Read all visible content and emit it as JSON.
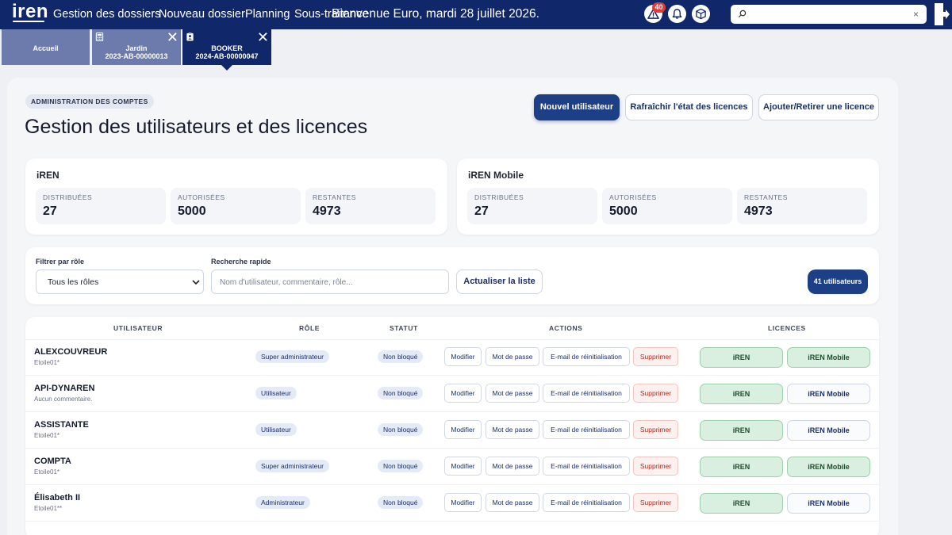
{
  "topbar": {
    "logo": "iren",
    "nav": [
      "Gestion des dossiers",
      "Nouveau dossier",
      "Planning",
      "Sous-traitance"
    ],
    "welcome": "Bienvenue Euro, mardi 28 juillet 2026.",
    "alert_count": "40",
    "icons": [
      "alert-triangle-icon",
      "bell-icon",
      "package-icon",
      "search-icon",
      "logout-icon"
    ],
    "search_clear": "×"
  },
  "tabs": [
    {
      "label": "Accueil"
    },
    {
      "line1": "Jardin",
      "line2": "2023-AB-00000013",
      "icon": "calculator-icon",
      "close": "✕"
    },
    {
      "line1": "BOOKER",
      "line2": "2024-AB-00000047",
      "icon": "id-card-icon",
      "close": "✕"
    }
  ],
  "page": {
    "breadcrumb": "ADMINISTRATION DES COMPTES",
    "title": "Gestion des utilisateurs et des licences",
    "buttons": {
      "new_user": "Nouvel utilisateur",
      "refresh": "Rafraîchir l'état des licences",
      "add_remove": "Ajouter/Retirer une licence"
    }
  },
  "licenses": [
    {
      "name": "iREN",
      "distributed_label": "DISTRIBUÉES",
      "distributed": "27",
      "authorized_label": "AUTORISÉES",
      "authorized": "5000",
      "remaining_label": "RESTANTES",
      "remaining": "4973"
    },
    {
      "name": "iREN Mobile",
      "distributed_label": "DISTRIBUÉES",
      "distributed": "27",
      "authorized_label": "AUTORISÉES",
      "authorized": "5000",
      "remaining_label": "RESTANTES",
      "remaining": "4973"
    }
  ],
  "filters": {
    "role_label": "Filtrer par rôle",
    "role_value": "Tous les rôles",
    "search_label": "Recherche rapide",
    "search_placeholder": "Nom d'utilisateur, commentaire, rôle...",
    "reload": "Actualiser la liste",
    "count": "41 utilisateurs"
  },
  "table": {
    "headers": {
      "user": "UTILISATEUR",
      "role": "RÔLE",
      "status": "STATUT",
      "actions": "ACTIONS",
      "licenses": "LICENCES"
    },
    "action_labels": {
      "edit": "Modifier",
      "password": "Mot de passe",
      "reset_mail": "E-mail de réinitialisation",
      "delete": "Supprimer"
    },
    "license_labels": {
      "iren": "iREN",
      "mobile": "iREN Mobile"
    },
    "rows": [
      {
        "name": "ALEXCOUVREUR",
        "comment": "Etoile01*",
        "role": "Super administrateur",
        "status": "Non bloqué",
        "iren": true,
        "mobile": true
      },
      {
        "name": "API-DYNAREN",
        "comment": "Aucun commentaire.",
        "role": "Utilisateur",
        "status": "Non bloqué",
        "iren": true,
        "mobile": false
      },
      {
        "name": "ASSISTANTE",
        "comment": "Etoile01*",
        "role": "Utilisateur",
        "status": "Non bloqué",
        "iren": true,
        "mobile": false
      },
      {
        "name": "COMPTA",
        "comment": "Etoile01*",
        "role": "Super administrateur",
        "status": "Non bloqué",
        "iren": true,
        "mobile": true
      },
      {
        "name": "Élisabeth II",
        "comment": "Etoile01**",
        "role": "Administrateur",
        "status": "Non bloqué",
        "iren": true,
        "mobile": false
      }
    ]
  },
  "colors": {
    "topbar": "#10286a",
    "tab_inactive": "#6c7bab",
    "primary": "#1c3f86",
    "license_on": "#d9efe0",
    "delete": "#b3281b",
    "alert_badge": "#e53935"
  }
}
